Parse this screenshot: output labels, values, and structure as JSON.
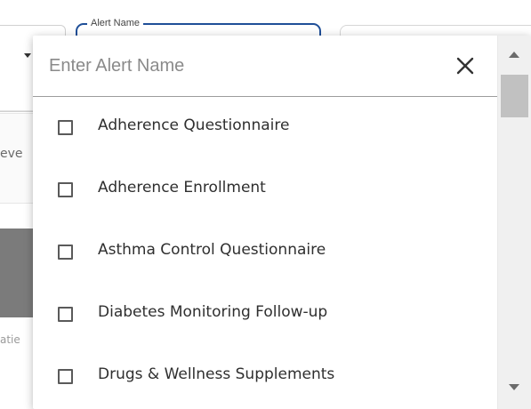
{
  "alert_field": {
    "label": "Alert Name"
  },
  "background": {
    "left_fragment_text": "eve",
    "left_fragment_text_2": "atie"
  },
  "dropdown": {
    "search": {
      "placeholder": "Enter Alert Name",
      "value": "",
      "clear_icon": "close-icon"
    },
    "options": [
      {
        "label": "Adherence Questionnaire",
        "checked": false
      },
      {
        "label": "Adherence Enrollment",
        "checked": false
      },
      {
        "label": "Asthma Control Questionnaire",
        "checked": false
      },
      {
        "label": "Diabetes Monitoring Follow-up",
        "checked": false
      },
      {
        "label": "Drugs & Wellness Supplements",
        "checked": false
      }
    ],
    "scrollbar": {
      "up_icon": "scroll-up-arrow-icon",
      "down_icon": "scroll-down-arrow-icon"
    }
  },
  "colors": {
    "focus_border": "#1f4f98",
    "divider": "#9c9c9c",
    "scroll_thumb": "#c1c1c1"
  }
}
